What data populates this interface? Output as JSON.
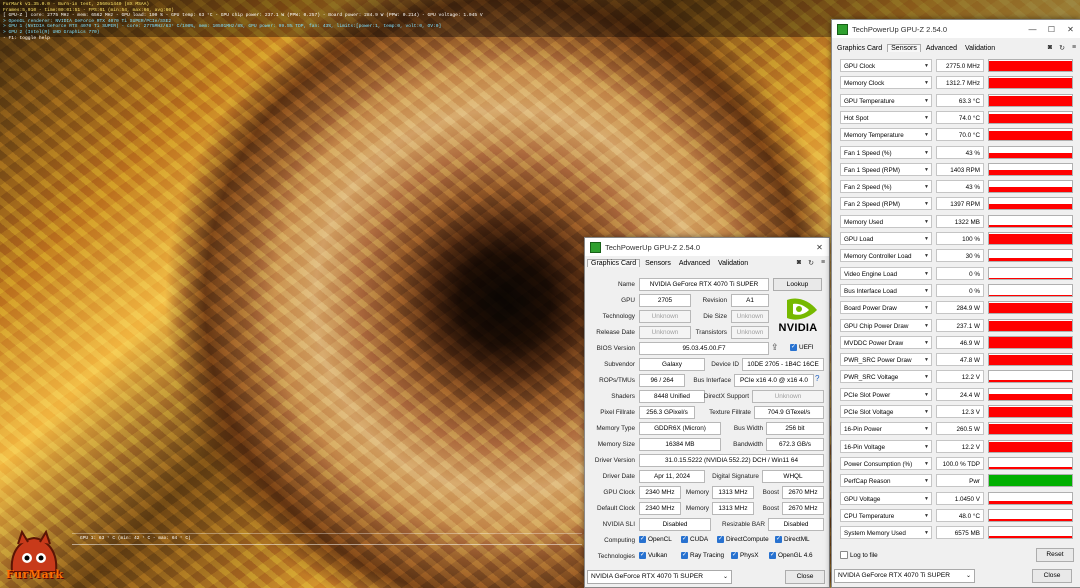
{
  "background": {
    "colors": {
      "gold": "#f3c25a",
      "brown": "#8a5a30"
    }
  },
  "osd": {
    "line1": "FurMark v1.35.0.0 - Burn-in test, 2560x1440 (8X MSAA)",
    "line2": "Frames:5,010 - time:00:01:51 - FPS:61 (min:54, max:66, avg:60)",
    "line3": "[ GPU-Z ] core: 2775 MHz - mem: 6562 MHz - GPU load: 100 % - GPU temp: 63 °C - GPU chip power: 237.1 W (PPW: 0.257) - Board power: 284.9 W (PPW: 0.214) - GPU voltage: 1.045 V",
    "line4": "> OpenGL renderer: NVIDIA GeForce RTX 4070 Ti SUPER/PCIe/SSE2",
    "line5": "> GPU 1 (NVIDIA GeForce RTX 4070 Ti SUPER) - core: 2775MHz/63° C/100%, mem: 10501MHz/8%, GPU power: 99.5% TDP, fan: 43%, limits:[power:1, temp:0, volt:0, OV:0]",
    "line6": "> GPU 2 (Intel(R) UHD Graphics 770)",
    "line7": "- F1: toggle help"
  },
  "furmark_graph": {
    "label": "GPU 1: 63 ° C (min: 42 ° C - max: 64 ° C)"
  },
  "furmark_logo": {
    "text": "FurMark"
  },
  "small_window": {
    "title": "TechPowerUp GPU-Z 2.54.0",
    "tabs": [
      "Graphics Card",
      "Sensors",
      "Advanced",
      "Validation"
    ],
    "rows": {
      "name_label": "Name",
      "name": "NVIDIA GeForce RTX 4070 Ti SUPER",
      "lookup": "Lookup",
      "gpu_label": "GPU",
      "gpu": "2705",
      "revision_label": "Revision",
      "revision": "A1",
      "technology_label": "Technology",
      "technology": "Unknown",
      "die_label": "Die Size",
      "die": "Unknown",
      "release_label": "Release Date",
      "release": "Unknown",
      "transistors_label": "Transistors",
      "transistors": "Unknown",
      "bios_label": "BIOS Version",
      "bios": "95.03.45.00.F7",
      "uefi": "UEFI",
      "subvendor_label": "Subvendor",
      "subvendor": "Galaxy",
      "device_label": "Device ID",
      "device": "10DE 2705 - 1B4C 16CE",
      "rops_label": "ROPs/TMUs",
      "rops": "96 / 264",
      "bus_label": "Bus Interface",
      "bus": "PCIe x16 4.0 @ x16 4.0",
      "shaders_label": "Shaders",
      "shaders": "8448 Unified",
      "dx_label": "DirectX Support",
      "dx": "Unknown",
      "pixel_label": "Pixel Fillrate",
      "pixel": "256.3 GPixel/s",
      "texture_label": "Texture Fillrate",
      "texture": "704.9 GTexel/s",
      "memtype_label": "Memory Type",
      "memtype": "GDDR6X (Micron)",
      "buswidth_label": "Bus Width",
      "buswidth": "256 bit",
      "memsize_label": "Memory Size",
      "memsize": "16384 MB",
      "bandwidth_label": "Bandwidth",
      "bandwidth": "672.3 GB/s",
      "driver_label": "Driver Version",
      "driver": "31.0.15.5222 (NVIDIA 552.22) DCH / Win11 64",
      "driverdate_label": "Driver Date",
      "driverdate": "Apr 11, 2024",
      "digsig_label": "Digital Signature",
      "digsig": "WHQL",
      "gpuclock_label": "GPU Clock",
      "gpuclock": "2340 MHz",
      "mem1_label": "Memory",
      "mem1": "1313 MHz",
      "boost1_label": "Boost",
      "boost1": "2670 MHz",
      "defclock_label": "Default Clock",
      "defclock": "2340 MHz",
      "mem2_label": "Memory",
      "mem2": "1313 MHz",
      "boost2_label": "Boost",
      "boost2": "2670 MHz",
      "sli_label": "NVIDIA SLI",
      "sli": "Disabled",
      "rebar_label": "Resizable BAR",
      "rebar": "Disabled",
      "computing_label": "Computing",
      "technologies_label": "Technologies"
    },
    "computing": [
      "OpenCL",
      "CUDA",
      "DirectCompute",
      "DirectML"
    ],
    "technologies": [
      "Vulkan",
      "Ray Tracing",
      "PhysX",
      "OpenGL 4.6"
    ],
    "footer_select": "NVIDIA GeForce RTX 4070 Ti SUPER",
    "close": "Close",
    "logo": "NVIDIA"
  },
  "big_window": {
    "title": "TechPowerUp GPU-Z 2.54.0",
    "tabs": [
      "Graphics Card",
      "Sensors",
      "Advanced",
      "Validation"
    ],
    "sensors": [
      {
        "name": "GPU Clock",
        "value": "2775.0 MHz",
        "level": 0.95,
        "color": "#ff0000"
      },
      {
        "name": "Memory Clock",
        "value": "1312.7 MHz",
        "level": 0.95,
        "color": "#ff0000"
      },
      {
        "name": "GPU Temperature",
        "value": "63.3 °C",
        "level": 0.85,
        "color": "#ff0000"
      },
      {
        "name": "Hot Spot",
        "value": "74.0 °C",
        "level": 0.85,
        "color": "#ff0000"
      },
      {
        "name": "Memory Temperature",
        "value": "70.0 °C",
        "level": 0.85,
        "color": "#ff0000"
      },
      {
        "name": "Fan 1 Speed (%)",
        "value": "43 %",
        "level": 0.45,
        "color": "#ff0000"
      },
      {
        "name": "Fan 1 Speed (RPM)",
        "value": "1403 RPM",
        "level": 0.45,
        "color": "#ff0000"
      },
      {
        "name": "Fan 2 Speed (%)",
        "value": "43 %",
        "level": 0.45,
        "color": "#ff0000"
      },
      {
        "name": "Fan 2 Speed (RPM)",
        "value": "1397 RPM",
        "level": 0.45,
        "color": "#ff0000"
      },
      {
        "name": "Memory Used",
        "value": "1322 MB",
        "level": 0.15,
        "color": "#ff0000"
      },
      {
        "name": "GPU Load",
        "value": "100 %",
        "level": 0.95,
        "color": "#ff0000"
      },
      {
        "name": "Memory Controller Load",
        "value": "30 %",
        "level": 0.3,
        "color": "#ff0000"
      },
      {
        "name": "Video Engine Load",
        "value": "0 %",
        "level": 0.0,
        "color": "#ff0000"
      },
      {
        "name": "Bus Interface Load",
        "value": "0 %",
        "level": 0.0,
        "color": "#ff0000"
      },
      {
        "name": "Board Power Draw",
        "value": "284.9 W",
        "level": 0.95,
        "color": "#ff0000"
      },
      {
        "name": "GPU Chip Power Draw",
        "value": "237.1 W",
        "level": 0.9,
        "color": "#ff0000"
      },
      {
        "name": "MVDDC Power Draw",
        "value": "46.9 W",
        "level": 0.95,
        "color": "#ff0000"
      },
      {
        "name": "PWR_SRC Power Draw",
        "value": "47.8 W",
        "level": 0.9,
        "color": "#ff0000"
      },
      {
        "name": "PWR_SRC Voltage",
        "value": "12.2 V",
        "level": 0.2,
        "color": "#ff0000"
      },
      {
        "name": "PCIe Slot Power",
        "value": "24.4 W",
        "level": 0.5,
        "color": "#ff0000"
      },
      {
        "name": "PCIe Slot Voltage",
        "value": "12.3 V",
        "level": 0.9,
        "color": "#ff0000"
      },
      {
        "name": "16-Pin Power",
        "value": "260.5 W",
        "level": 0.9,
        "color": "#ff0000"
      },
      {
        "name": "16-Pin Voltage",
        "value": "12.2 V",
        "level": 0.9,
        "color": "#ff0000"
      },
      {
        "name": "Power Consumption (%)",
        "value": "100.0 % TDP",
        "level": 0.2,
        "color": "#ff0000"
      },
      {
        "name": "PerfCap Reason",
        "value": "Pwr",
        "level": 1.0,
        "color": "#00b000"
      },
      {
        "name": "GPU Voltage",
        "value": "1.0450 V",
        "level": 0.2,
        "color": "#ff0000"
      },
      {
        "name": "CPU Temperature",
        "value": "48.0 °C",
        "level": 0.15,
        "color": "#ff0000"
      },
      {
        "name": "System Memory Used",
        "value": "6575 MB",
        "level": 0.15,
        "color": "#ff0000"
      }
    ],
    "log_label": "Log to file",
    "reset": "Reset",
    "footer_select": "NVIDIA GeForce RTX 4070 Ti SUPER",
    "close": "Close"
  }
}
